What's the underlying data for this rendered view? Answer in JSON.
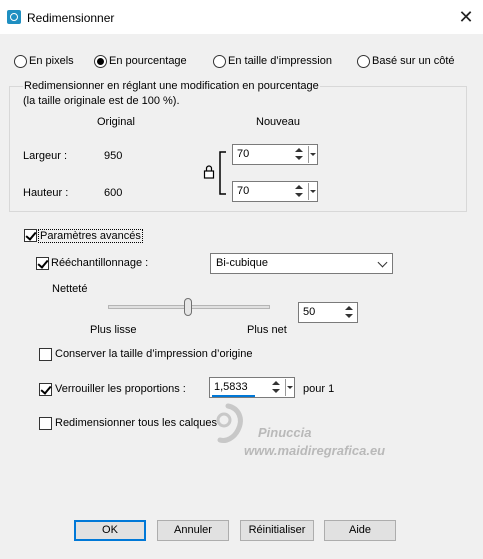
{
  "window": {
    "title": "Redimensionner"
  },
  "modes": [
    {
      "label": "En pixels",
      "selected": false
    },
    {
      "label": "En pourcentage",
      "selected": true
    },
    {
      "label": "En taille d’impression",
      "selected": false
    },
    {
      "label": "Basé sur un côté",
      "selected": false
    }
  ],
  "group": {
    "legend_line1": "Redimensionner en réglant une modification en pourcentage",
    "legend_line2": "(la taille originale est de 100 %).",
    "col_original": "Original",
    "col_nouveau": "Nouveau",
    "width_label": "Largeur :",
    "width_original": "950",
    "width_new": "70",
    "height_label": "Hauteur :",
    "height_original": "600",
    "height_new": "70"
  },
  "advanced": {
    "label": "Paramètres avancés",
    "checked": true,
    "resample_label": "Rééchantillonnage :",
    "resample_checked": true,
    "resample_value": "Bi-cubique",
    "sharpness_label": "Netteté",
    "sharpness_min_label": "Plus lisse",
    "sharpness_max_label": "Plus net",
    "sharpness_value": "50",
    "keep_print_size_label": "Conserver la taille d’impression d’origine",
    "keep_print_size_checked": false,
    "lock_ratio_label": "Verrouiller les proportions :",
    "lock_ratio_checked": true,
    "ratio_value": "1,5833",
    "ratio_suffix": "pour 1",
    "resize_all_layers_label": "Redimensionner tous les calques",
    "resize_all_layers_checked": false
  },
  "watermark": {
    "line1": "Pinuccia",
    "line2": "www.maidiregrafica.eu"
  },
  "buttons": {
    "ok": "OK",
    "cancel": "Annuler",
    "reset": "Réinitialiser",
    "help": "Aide"
  }
}
